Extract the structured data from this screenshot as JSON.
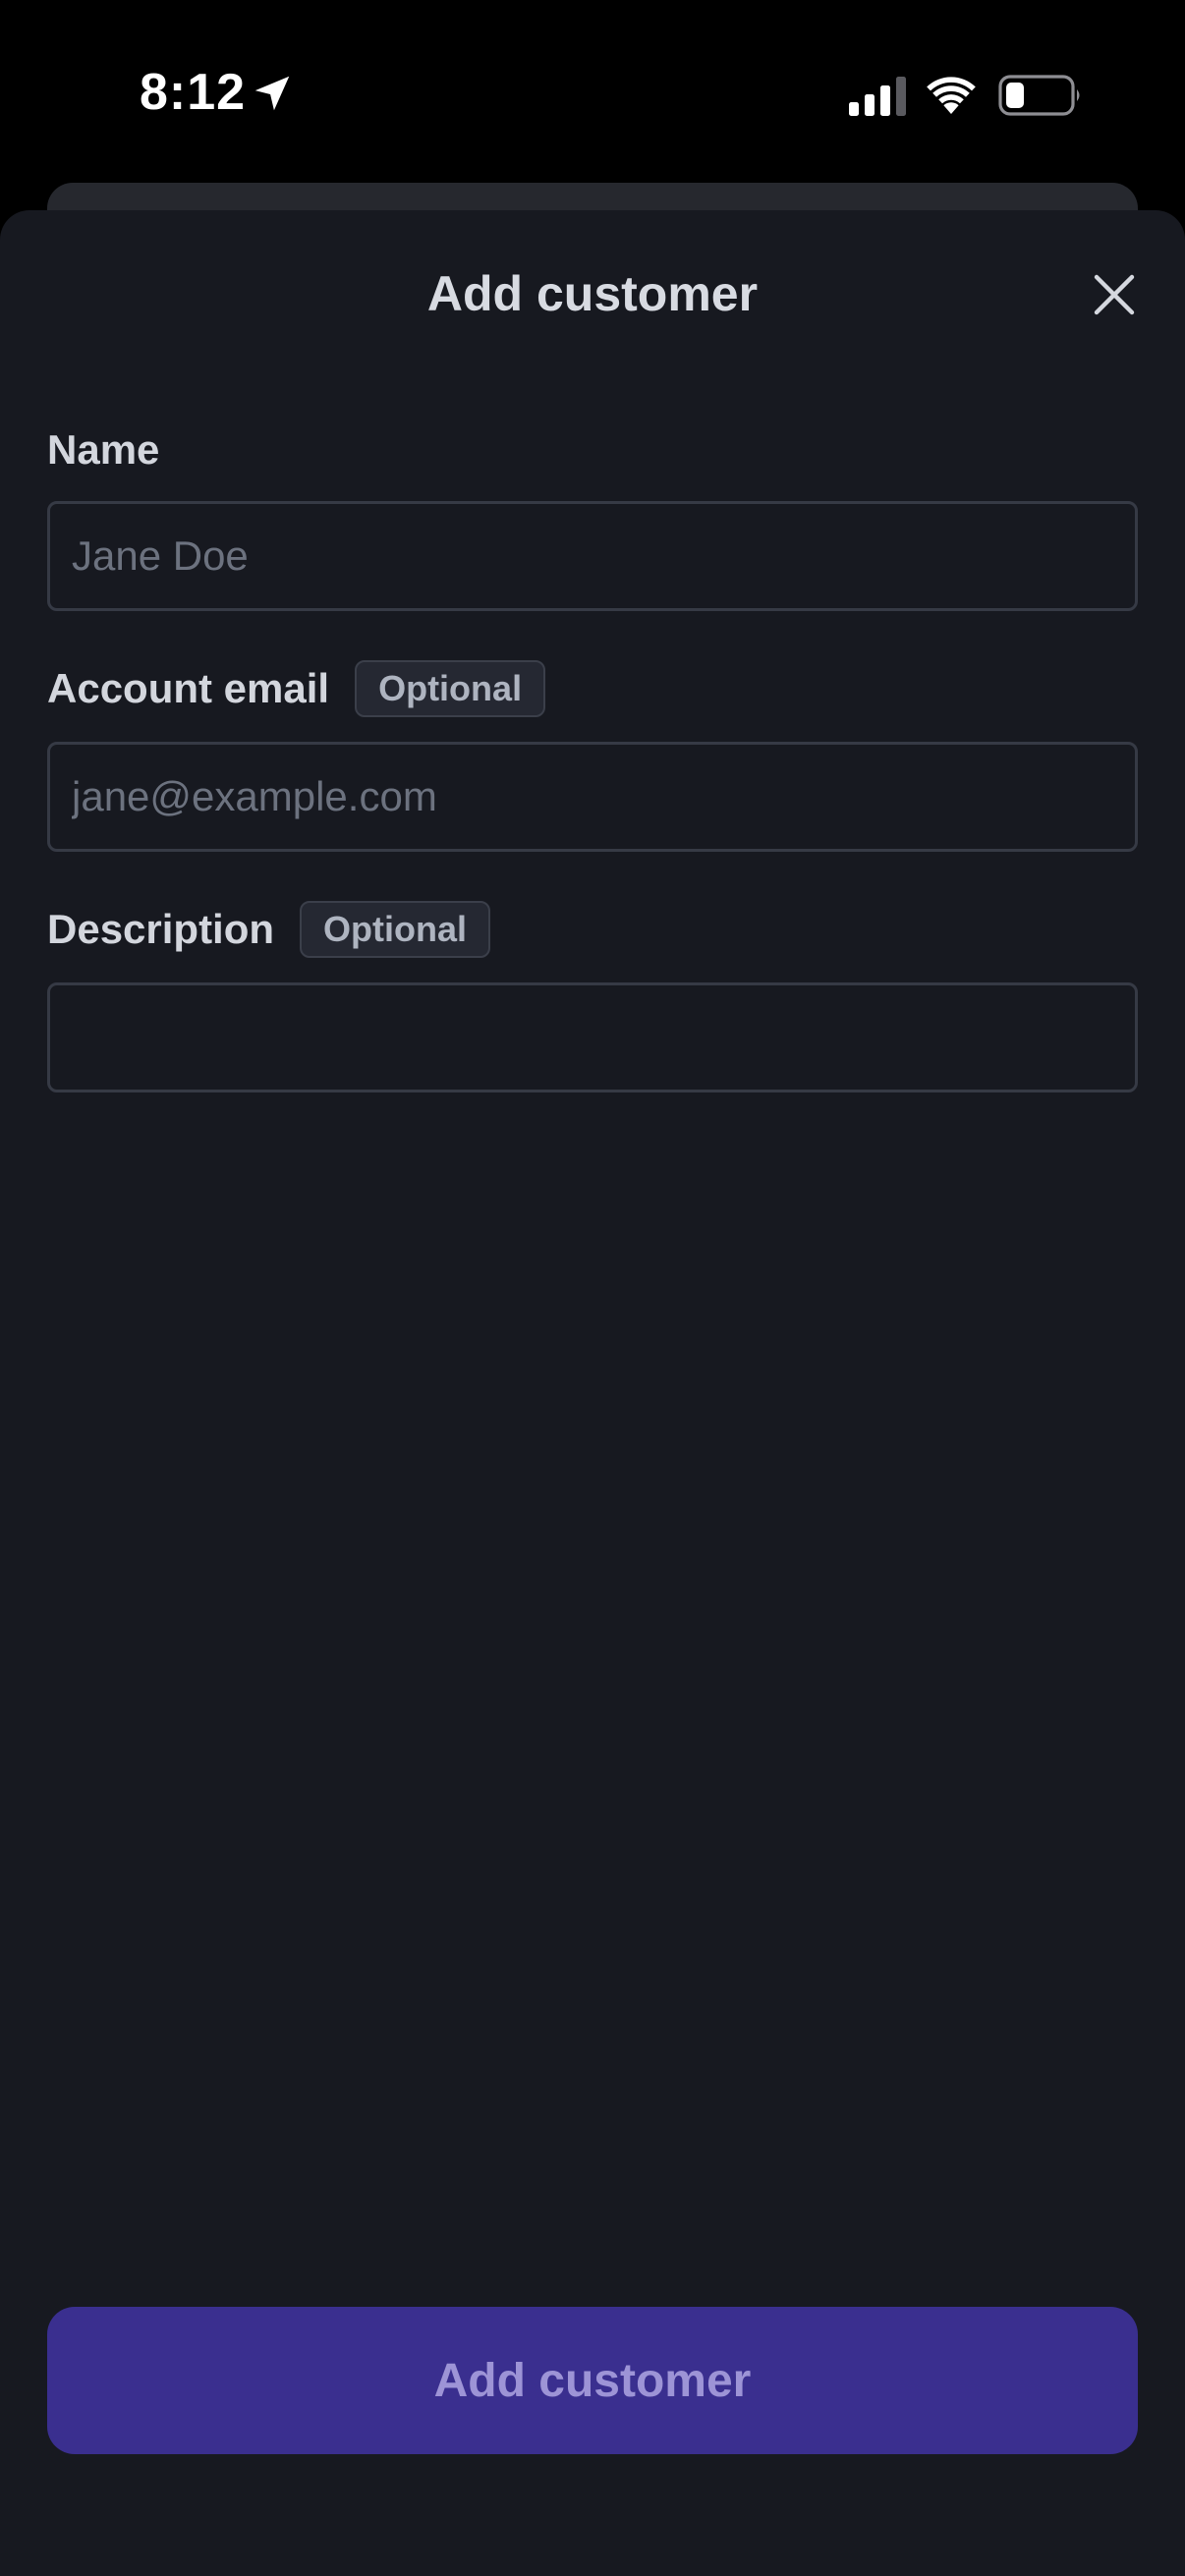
{
  "status_bar": {
    "time": "8:12",
    "icons": [
      "location-arrow-icon",
      "cellular-signal-icon",
      "wifi-icon",
      "battery-icon"
    ]
  },
  "sheet": {
    "title": "Add customer",
    "close_icon": "close-icon"
  },
  "form": {
    "name": {
      "label": "Name",
      "placeholder": "Jane Doe",
      "value": ""
    },
    "email": {
      "label": "Account email",
      "badge": "Optional",
      "placeholder": "jane@example.com",
      "value": ""
    },
    "description": {
      "label": "Description",
      "badge": "Optional",
      "placeholder": "",
      "value": ""
    }
  },
  "submit": {
    "label": "Add customer"
  },
  "colors": {
    "sheet_background": "#171920",
    "submit_background": "#3a2f8f",
    "submit_text": "#9d94d6",
    "input_border": "#363a45"
  }
}
